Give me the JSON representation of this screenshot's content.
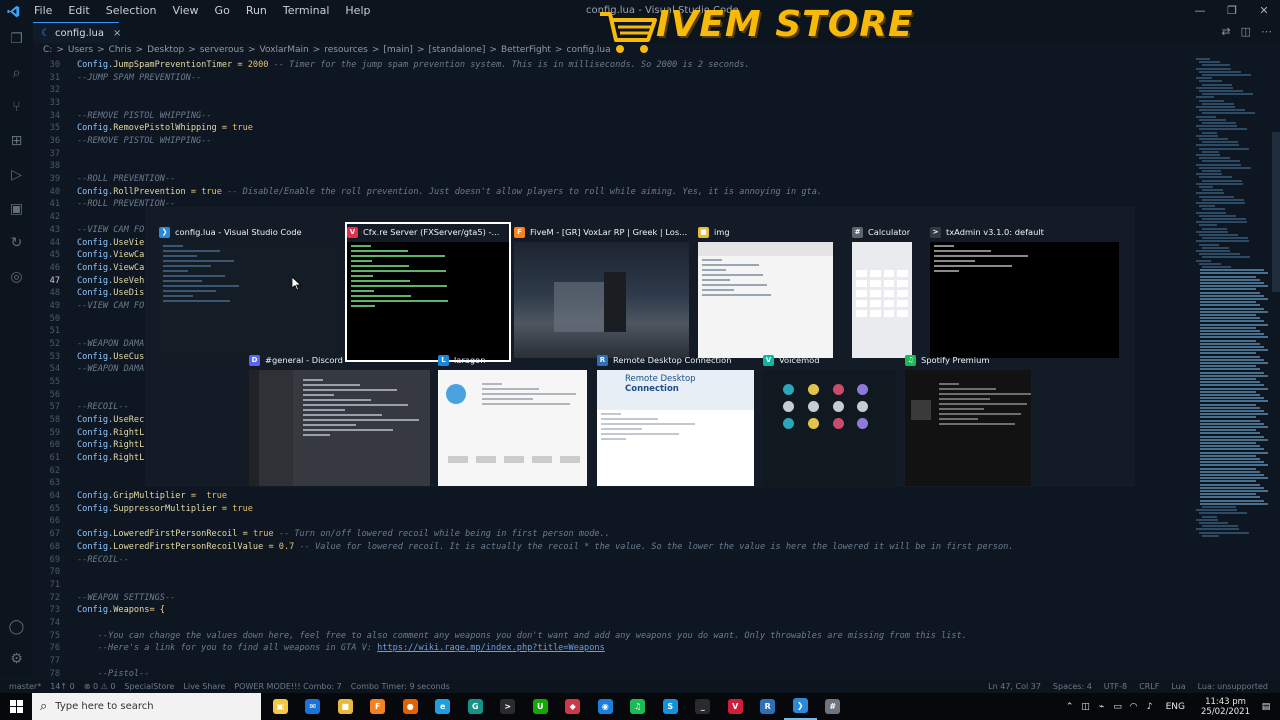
{
  "window": {
    "menu": [
      "File",
      "Edit",
      "Selection",
      "View",
      "Go",
      "Run",
      "Terminal",
      "Help"
    ],
    "title": "config.lua - Visual Studio Code",
    "controls": [
      "—",
      "❐",
      "✕"
    ]
  },
  "watermark": {
    "text": "IVEM STORE"
  },
  "tab": {
    "icon": "lua-file-icon",
    "label": "config.lua",
    "close": "×"
  },
  "breadcrumb": [
    "C:",
    ">",
    "Users",
    ">",
    "Chris",
    ">",
    "Desktop",
    ">",
    "serverous",
    ">",
    "VoxlarMain",
    ">",
    "resources",
    ">",
    "[main]",
    ">",
    "[standalone]",
    ">",
    "BetterFight",
    ">",
    "config.lua"
  ],
  "editor": {
    "current_line": 47,
    "lines": [
      {
        "n": 30,
        "parts": [
          [
            "k",
            "Config."
          ],
          [
            "p",
            "JumpSpamPreventionTimer"
          ],
          [
            "n",
            " = "
          ],
          [
            "v",
            "2000"
          ],
          [
            "c",
            " -- Timer for the jump spam prevention system. This is in milliseconds. So 2000 is 2 seconds."
          ]
        ]
      },
      {
        "n": 31,
        "parts": [
          [
            "c",
            "--JUMP SPAM PREVENTION--"
          ]
        ]
      },
      {
        "n": 32,
        "parts": []
      },
      {
        "n": 33,
        "parts": []
      },
      {
        "n": 34,
        "parts": [
          [
            "c",
            "--REMOVE PISTOL WHIPPING--"
          ]
        ]
      },
      {
        "n": 35,
        "parts": [
          [
            "k",
            "Config."
          ],
          [
            "p",
            "RemovePistolWhipping"
          ],
          [
            "n",
            " = "
          ],
          [
            "v",
            "true"
          ]
        ]
      },
      {
        "n": 36,
        "parts": [
          [
            "c",
            "--REMOVE PISTOL WHIPPING--"
          ]
        ]
      },
      {
        "n": 37,
        "parts": []
      },
      {
        "n": 38,
        "parts": []
      },
      {
        "n": 39,
        "parts": [
          [
            "c",
            "--ROLL PREVENTION--"
          ]
        ]
      },
      {
        "n": 40,
        "parts": [
          [
            "k",
            "Config."
          ],
          [
            "p",
            "RollPrevention"
          ],
          [
            "n",
            " = "
          ],
          [
            "v",
            "true"
          ],
          [
            "c",
            " -- Disable/Enable the roll prevention. Just doesn't allow players to roll while aiming. Yes, it is annoying in gta."
          ]
        ]
      },
      {
        "n": 41,
        "parts": [
          [
            "c",
            "--ROLL PREVENTION--"
          ]
        ]
      },
      {
        "n": 42,
        "parts": []
      },
      {
        "n": 43,
        "parts": [
          [
            "c",
            "--VIEW CAM FO"
          ]
        ]
      },
      {
        "n": 44,
        "parts": [
          [
            "k",
            "Config."
          ],
          [
            "p",
            "UseVie"
          ]
        ]
      },
      {
        "n": 45,
        "parts": [
          [
            "k",
            "Config."
          ],
          [
            "p",
            "ViewCa"
          ]
        ]
      },
      {
        "n": 46,
        "parts": [
          [
            "k",
            "Config."
          ],
          [
            "p",
            "ViewCa"
          ]
        ]
      },
      {
        "n": 47,
        "parts": [
          [
            "k",
            "Config."
          ],
          [
            "p",
            "UseVeh"
          ]
        ]
      },
      {
        "n": 48,
        "parts": [
          [
            "k",
            "Config."
          ],
          [
            "p",
            "UseDis"
          ]
        ]
      },
      {
        "n": 49,
        "parts": [
          [
            "c",
            "--VIEW CAM FO"
          ]
        ]
      },
      {
        "n": 50,
        "parts": []
      },
      {
        "n": 51,
        "parts": []
      },
      {
        "n": 52,
        "parts": [
          [
            "c",
            "--WEAPON DAMA"
          ]
        ]
      },
      {
        "n": 53,
        "parts": [
          [
            "k",
            "Config."
          ],
          [
            "p",
            "UseCus"
          ]
        ]
      },
      {
        "n": 54,
        "parts": [
          [
            "c",
            "--WEAPON DAMA"
          ]
        ]
      },
      {
        "n": 55,
        "parts": []
      },
      {
        "n": 56,
        "parts": []
      },
      {
        "n": 57,
        "parts": [
          [
            "c",
            "--RECOIL--"
          ]
        ]
      },
      {
        "n": 58,
        "parts": [
          [
            "k",
            "Config."
          ],
          [
            "p",
            "UseRec"
          ]
        ]
      },
      {
        "n": 59,
        "parts": [
          [
            "k",
            "Config."
          ],
          [
            "p",
            "RightL"
          ]
        ]
      },
      {
        "n": 60,
        "parts": [
          [
            "k",
            "Config."
          ],
          [
            "p",
            "RightL"
          ]
        ]
      },
      {
        "n": 61,
        "parts": [
          [
            "k",
            "Config."
          ],
          [
            "p",
            "RightL"
          ]
        ]
      },
      {
        "n": 62,
        "parts": []
      },
      {
        "n": 63,
        "parts": []
      },
      {
        "n": 64,
        "parts": [
          [
            "k",
            "Config."
          ],
          [
            "p",
            "GripMultiplier"
          ],
          [
            "n",
            " =  "
          ],
          [
            "v",
            "true"
          ]
        ]
      },
      {
        "n": 65,
        "parts": [
          [
            "k",
            "Config."
          ],
          [
            "p",
            "SuppressorMultiplier"
          ],
          [
            "n",
            " = "
          ],
          [
            "v",
            "true"
          ]
        ]
      },
      {
        "n": 66,
        "parts": []
      },
      {
        "n": 67,
        "parts": [
          [
            "k",
            "Config."
          ],
          [
            "p",
            "LoweredFirstPersonRecoil"
          ],
          [
            "n",
            " = "
          ],
          [
            "v",
            "true"
          ],
          [
            "c",
            " -- Turn on/off lowered recoil while being in first person mode.."
          ]
        ]
      },
      {
        "n": 68,
        "parts": [
          [
            "k",
            "Config."
          ],
          [
            "p",
            "LoweredFirstPersonRecoilValue"
          ],
          [
            "n",
            " = "
          ],
          [
            "v",
            "0.7"
          ],
          [
            "c",
            " -- Value for lowered recoil. It is actually the recoil * the value. So the lower the value is here the lowered it will be in first person."
          ]
        ]
      },
      {
        "n": 69,
        "parts": [
          [
            "c",
            "--RECOIL--"
          ]
        ]
      },
      {
        "n": 70,
        "parts": []
      },
      {
        "n": 71,
        "parts": []
      },
      {
        "n": 72,
        "parts": [
          [
            "c",
            "--WEAPON SETTINGS--"
          ]
        ]
      },
      {
        "n": 73,
        "parts": [
          [
            "k",
            "Config."
          ],
          [
            "p",
            "Weapons"
          ],
          [
            "n",
            "= {"
          ]
        ]
      },
      {
        "n": 74,
        "parts": []
      },
      {
        "n": 75,
        "parts": [
          [
            "c",
            "    --You can change the values down here, feel free to also comment any weapons you don't want and add any weapons you do want. Only throwables are missing from this list."
          ]
        ]
      },
      {
        "n": 76,
        "parts": [
          [
            "c",
            "    --Here's a link for you to find all weapons in GTA V: "
          ],
          [
            "u",
            "https://wiki.rage.mp/index.php?title=Weapons"
          ]
        ]
      },
      {
        "n": 77,
        "parts": []
      },
      {
        "n": 78,
        "parts": [
          [
            "c",
            "    --Pistol--"
          ]
        ]
      }
    ]
  },
  "switcher": {
    "row1": [
      {
        "title": "config.lua - Visual Studio Code",
        "icon": "vscode-icon",
        "color": "#2a8ad8",
        "glyph": "❯",
        "thumb": "vscode"
      },
      {
        "title": "Cfx.re Server (FXServer/gta5) -...",
        "icon": "cfx-icon",
        "color": "#e0304a",
        "glyph": "V",
        "thumb": "console"
      },
      {
        "title": "FiveM - [GR] VoxLar RP | Greek | Los...",
        "icon": "fivem-icon",
        "color": "#f58220",
        "glyph": "F",
        "thumb": "game"
      },
      {
        "title": "img",
        "icon": "folder-icon",
        "color": "#e8b93a",
        "glyph": "■",
        "thumb": "explorer"
      },
      {
        "title": "Calculator",
        "icon": "calculator-icon",
        "color": "#5d6470",
        "glyph": "#",
        "thumb": "calculator"
      },
      {
        "title": "txAdmin v3.1.0: default",
        "icon": "txadmin-icon",
        "color": "#333a44",
        "glyph": ">",
        "thumb": "terminal"
      }
    ],
    "row2": [
      {
        "title": "#general - Discord",
        "icon": "discord-icon",
        "color": "#5865f2",
        "glyph": "D",
        "thumb": "discord"
      },
      {
        "title": "laragon",
        "icon": "laragon-icon",
        "color": "#1e88d8",
        "glyph": "L",
        "thumb": "laragon"
      },
      {
        "title": "Remote Desktop Connection",
        "icon": "rdp-icon",
        "color": "#2f6fb8",
        "glyph": "R",
        "thumb": "rdp"
      },
      {
        "title": "Voicemod",
        "icon": "voicemod-icon",
        "color": "#12b4a0",
        "glyph": "V",
        "thumb": "voicemod"
      },
      {
        "title": "Spotify Premium",
        "icon": "spotify-icon",
        "color": "#1db954",
        "glyph": "♫",
        "thumb": "spotify"
      }
    ],
    "selected": 1,
    "rdp_thumb": {
      "heading1": "Remote Desktop",
      "heading2": "Connection"
    }
  },
  "statusbar": {
    "left": [
      "master*",
      "14↑ 0",
      "⊗ 0 ⚠ 0",
      "SpecialStore",
      "Live Share",
      "POWER MODE!!! Combo: 7",
      "Combo Timer: 9 seconds"
    ],
    "right": [
      "Ln 47, Col 37",
      "Spaces: 4",
      "UTF-8",
      "CRLF",
      "Lua",
      "Lua: unsupported"
    ]
  },
  "taskbar": {
    "search_placeholder": "Type here to search",
    "apps": [
      {
        "name": "store-app",
        "color": "#f3c842",
        "glyph": "▣"
      },
      {
        "name": "mail-app",
        "color": "#1a73d8",
        "glyph": "✉"
      },
      {
        "name": "file-explorer-app",
        "color": "#e8b93a",
        "glyph": "■"
      },
      {
        "name": "fivem-app",
        "color": "#f58220",
        "glyph": "F"
      },
      {
        "name": "firefox-app",
        "color": "#e66000",
        "glyph": "●"
      },
      {
        "name": "edge-app",
        "color": "#1ba1e2",
        "glyph": "e"
      },
      {
        "name": "gitkraken-app",
        "color": "#179287",
        "glyph": "G"
      },
      {
        "name": "terminal-app",
        "color": "#2b2b2b",
        "glyph": ">"
      },
      {
        "name": "upwork-app",
        "color": "#14a800",
        "glyph": "U"
      },
      {
        "name": "unknown-app",
        "color": "#cc3a4a",
        "glyph": "◆"
      },
      {
        "name": "wallet-app",
        "color": "#1a7fd8",
        "glyph": "◉"
      },
      {
        "name": "spotify-app",
        "color": "#1db954",
        "glyph": "♫"
      },
      {
        "name": "skype-app",
        "color": "#1292d8",
        "glyph": "S"
      },
      {
        "name": "console-app",
        "color": "#2b2b2b",
        "glyph": "_"
      },
      {
        "name": "cfx-app",
        "color": "#d01f3a",
        "glyph": "V"
      },
      {
        "name": "remote-desktop-app",
        "color": "#2f6fb8",
        "glyph": "R"
      },
      {
        "name": "vscode-app",
        "color": "#2a8ad8",
        "glyph": "❯"
      },
      {
        "name": "calculator-app",
        "color": "#6d7480",
        "glyph": "#"
      }
    ],
    "active_app": 16,
    "tray": {
      "lang": "ENG",
      "time": "11:43 pm",
      "date": "25/02/2021"
    }
  },
  "colors": {
    "accent": "#3794ff",
    "watermark": "#f7b90a",
    "editor_bg": "#0e1621"
  }
}
